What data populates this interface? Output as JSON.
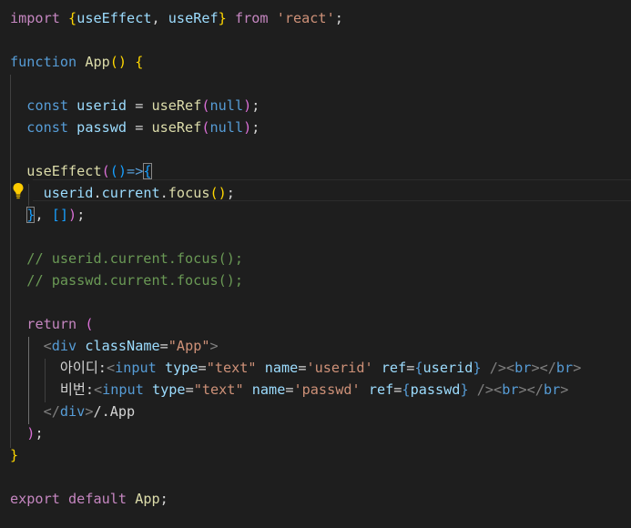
{
  "code": {
    "l1": {
      "kw_import": "import",
      "brace_open": "{",
      "id1": "useEffect",
      "comma": ", ",
      "id2": "useRef",
      "brace_close": "}",
      "kw_from": "from",
      "str": "'react'",
      "semi": ";"
    },
    "l3": {
      "kw_function": "function",
      "name": "App",
      "parens": "()",
      "brace": "{"
    },
    "l5": {
      "kw_const": "const",
      "var": "userid",
      "eq": " = ",
      "fn": "useRef",
      "po": "(",
      "arg": "null",
      "pc": ")",
      "semi": ";"
    },
    "l6": {
      "kw_const": "const",
      "var": "passwd",
      "eq": " = ",
      "fn": "useRef",
      "po": "(",
      "arg": "null",
      "pc": ")",
      "semi": ";"
    },
    "l8": {
      "fn": "useEffect",
      "po": "(",
      "arrow_params": "()",
      "arrow": "=>",
      "brace": "{"
    },
    "l9": {
      "obj": "userid",
      "dot1": ".",
      "prop": "current",
      "dot2": ".",
      "method": "focus",
      "call": "()",
      "semi": ";"
    },
    "l10": {
      "brace": "}",
      "comma": ", ",
      "arr": "[]",
      "pc": ")",
      "semi": ";"
    },
    "l12": {
      "text": "// userid.current.focus();"
    },
    "l13": {
      "text": "// passwd.current.focus();"
    },
    "l15": {
      "kw_return": "return",
      "po": "("
    },
    "l16": {
      "lt": "<",
      "tag": "div",
      "attr": "className",
      "eq": "=",
      "val": "\"App\"",
      "gt": ">"
    },
    "l17": {
      "label": "아이디:",
      "lt": "<",
      "tag": "input",
      "a1": "type",
      "eq1": "=",
      "v1": "\"text\"",
      "a2": "name",
      "eq2": "=",
      "v2": "'userid'",
      "a3": "ref",
      "eq3": "=",
      "bo": "{",
      "v3": "userid",
      "bc": "}",
      "close": " />",
      "br_lt": "<",
      "br_tag": "br",
      "br_gt": ">",
      "cbr_lt": "</",
      "cbr_tag": "br",
      "cbr_gt": ">"
    },
    "l18": {
      "label": "비번:",
      "lt": "<",
      "tag": "input",
      "a1": "type",
      "eq1": "=",
      "v1": "\"text\"",
      "a2": "name",
      "eq2": "=",
      "v2": "'passwd'",
      "a3": "ref",
      "eq3": "=",
      "bo": "{",
      "v3": "passwd",
      "bc": "}",
      "close": " />",
      "br_lt": "<",
      "br_tag": "br",
      "br_gt": ">",
      "cbr_lt": "</",
      "cbr_tag": "br",
      "cbr_gt": ">"
    },
    "l19": {
      "lt": "</",
      "tag": "div",
      "gt": ">",
      "comment": "/.App"
    },
    "l20": {
      "pc": ")",
      "semi": ";"
    },
    "l21": {
      "brace": "}"
    },
    "l23": {
      "kw_export": "export",
      "kw_default": "default",
      "name": "App",
      "semi": ";"
    }
  },
  "colors": {
    "background": "#1e1e1e",
    "keyword": "#569cd6",
    "control": "#c586c0",
    "variable": "#9cdcfe",
    "function": "#dcdcaa",
    "string": "#ce9178",
    "comment": "#6a9955",
    "bracket_gold": "#ffd700",
    "bracket_orchid": "#da70d6",
    "bracket_blue": "#179fff"
  },
  "icons": {
    "lightbulb": "lightbulb-icon"
  }
}
